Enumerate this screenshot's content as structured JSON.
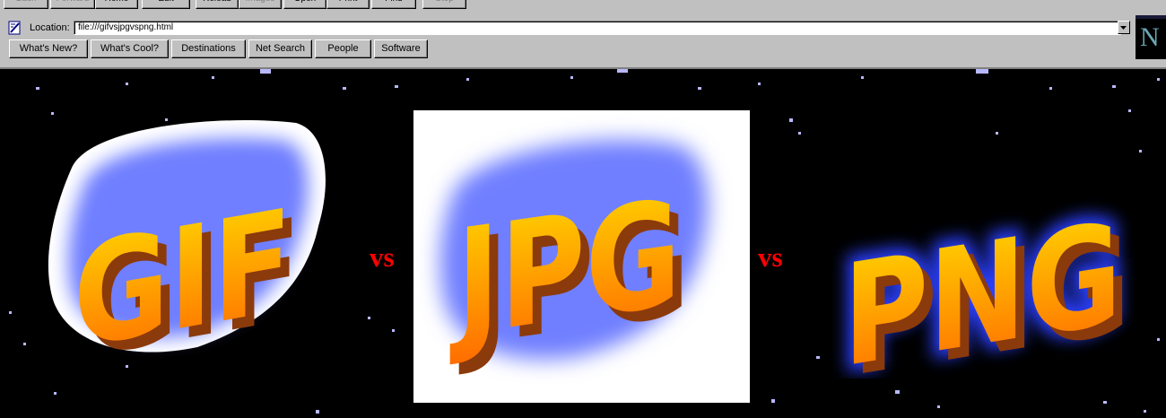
{
  "toolbar": {
    "buttons": [
      {
        "label": "Back",
        "enabled": false
      },
      {
        "label": "Forward",
        "enabled": false
      },
      {
        "label": "Home",
        "enabled": true
      },
      {
        "label": "Edit",
        "enabled": true
      },
      {
        "label": "Reload",
        "enabled": true
      },
      {
        "label": "Images",
        "enabled": false
      },
      {
        "label": "Open",
        "enabled": true
      },
      {
        "label": "Print",
        "enabled": true
      },
      {
        "label": "Find",
        "enabled": true
      },
      {
        "label": "Stop",
        "enabled": false
      }
    ]
  },
  "location": {
    "label": "Location:",
    "url": "file:///gifvsjpgvspng.html"
  },
  "links": [
    {
      "label": "What's New?"
    },
    {
      "label": "What's Cool?"
    },
    {
      "label": "Destinations"
    },
    {
      "label": "Net Search"
    },
    {
      "label": "People"
    },
    {
      "label": "Software"
    }
  ],
  "throbber": {
    "letter": "N"
  },
  "page": {
    "images": [
      {
        "text": "GIF",
        "background": "transparent-black"
      },
      {
        "text": "JPG",
        "background": "white"
      },
      {
        "text": "PNG",
        "background": "transparent-black"
      }
    ],
    "separators": [
      "vs",
      "vs"
    ]
  },
  "colors": {
    "chrome": "#c0c0c0",
    "page_background": "#000000",
    "vs_text": "#ff0000",
    "letter_top": "#ffd200",
    "letter_bottom": "#ff6a00",
    "letter_side": "#8b3a0c",
    "glow_blue": "#7f8fff"
  }
}
